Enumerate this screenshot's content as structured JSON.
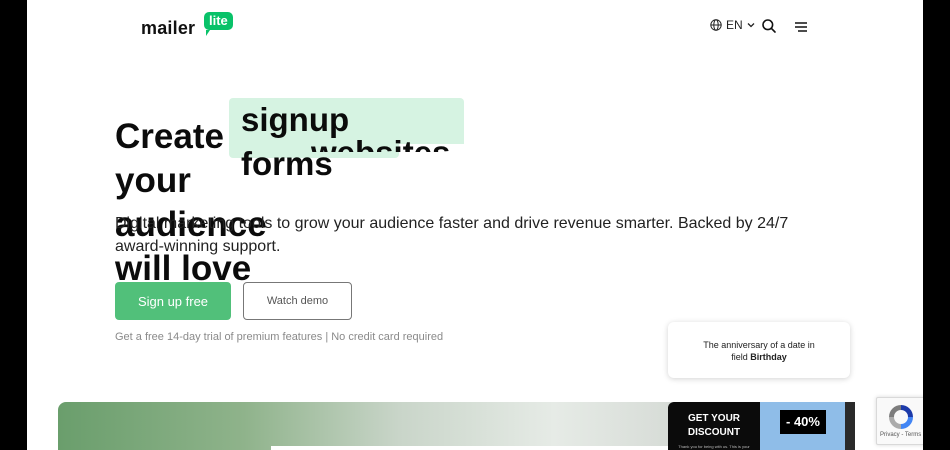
{
  "header": {
    "logo_text": "mailer",
    "logo_badge": "lite",
    "language": "EN"
  },
  "hero": {
    "headline_prefix": "Create",
    "headline_highlight": "signup forms",
    "headline_highlight_next": "websites",
    "headline_line2": "your audience will love",
    "description": "Digital marketing tools to grow your audience faster and drive revenue smarter. Backed by 24/7 award-winning support.",
    "signup_label": "Sign up free",
    "demo_label": "Watch demo",
    "trial_note": "Get a free 14-day trial of premium features | No credit card required"
  },
  "tooltip": {
    "line1": "The anniversary of a date in",
    "line2_prefix": "field ",
    "line2_field": "Birthday"
  },
  "promo": {
    "title_line1": "GET YOUR",
    "title_line2": "DISCOUNT",
    "small_text": "Thank you for being with us. This is your",
    "discount": "- 40%"
  },
  "recaptcha": {
    "links": "Privacy - Terms"
  },
  "colors": {
    "brand_green": "#09c269",
    "button_green": "#51c07a",
    "highlight_bg": "#d6f3e2"
  }
}
